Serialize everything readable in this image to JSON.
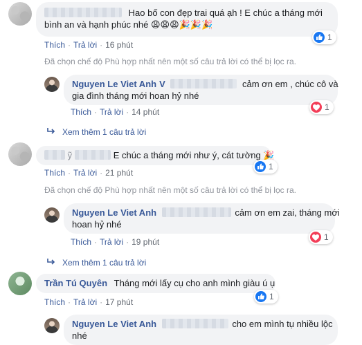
{
  "comments": [
    {
      "text": "Hao bố con đẹp trai quá ạh ! E chúc a tháng mới",
      "text2": "bình an và hạnh phúc nhé",
      "emojis": "😩😩😩🎉🎉🎉",
      "actions": {
        "like": "Thích",
        "reply": "Trả lời",
        "time": "16 phút"
      },
      "reaction_count": "1",
      "notice": "Đã chọn chế độ Phù hợp nhất nên một số câu trả lời có thể bị lọc ra.",
      "reply": {
        "name": "Nguyen Le Viet Anh",
        "name_suffix": "V",
        "text": "cảm ơn em , chúc cô và",
        "text2": "gia đình tháng mới hoan hỷ nhé",
        "actions": {
          "like": "Thích",
          "reply": "Trả lời",
          "time": "14 phút"
        },
        "reaction_count": "1"
      },
      "more_replies": "Xem thêm 1 câu trả lời"
    },
    {
      "name_prefix": " ỹ",
      "text": "E chúc a tháng mới như ý, cát tường",
      "emojis": "🎉",
      "actions": {
        "like": "Thích",
        "reply": "Trả lời",
        "time": "21 phút"
      },
      "reaction_count": "1",
      "notice": "Đã chọn chế độ Phù hợp nhất nên một số câu trả lời có thể bị lọc ra.",
      "reply": {
        "name": "Nguyen Le Viet Anh",
        "text": "cảm ơn em zai, tháng mới",
        "text2": "hoan hỷ nhé",
        "actions": {
          "like": "Thích",
          "reply": "Trả lời",
          "time": "19 phút"
        },
        "reaction_count": "1"
      },
      "more_replies": "Xem thêm 1 câu trả lời"
    },
    {
      "name": "Trần Tú Quyên",
      "text": "Tháng mới lấy cụ cho anh mình giàu ú ụ",
      "actions": {
        "like": "Thích",
        "reply": "Trả lời",
        "time": "17 phút"
      },
      "reaction_count": "1",
      "reply": {
        "name": "Nguyen Le Viet Anh",
        "text": "cho em mình tụ nhiều lộc",
        "text2": "nhé"
      }
    }
  ],
  "colors": {
    "link": "#385898",
    "bubble": "#f2f3f5",
    "like": "#1877f2",
    "love": "#f33e58"
  }
}
